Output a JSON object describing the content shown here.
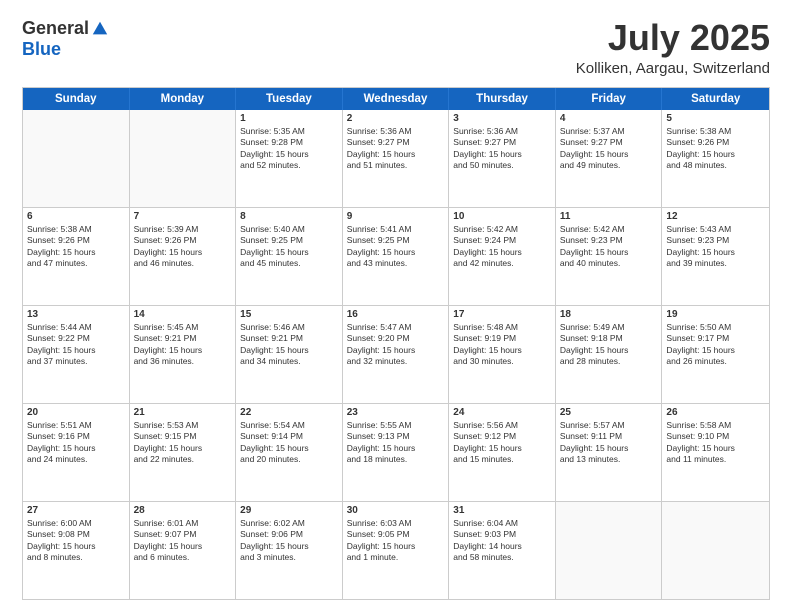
{
  "header": {
    "logo": {
      "general": "General",
      "blue": "Blue"
    },
    "title": "July 2025",
    "subtitle": "Kolliken, Aargau, Switzerland"
  },
  "calendar": {
    "days": [
      "Sunday",
      "Monday",
      "Tuesday",
      "Wednesday",
      "Thursday",
      "Friday",
      "Saturday"
    ],
    "rows": [
      [
        {
          "day": "",
          "empty": true
        },
        {
          "day": "",
          "empty": true
        },
        {
          "day": "1",
          "sunrise": "Sunrise: 5:35 AM",
          "sunset": "Sunset: 9:28 PM",
          "daylight": "Daylight: 15 hours and 52 minutes."
        },
        {
          "day": "2",
          "sunrise": "Sunrise: 5:36 AM",
          "sunset": "Sunset: 9:27 PM",
          "daylight": "Daylight: 15 hours and 51 minutes."
        },
        {
          "day": "3",
          "sunrise": "Sunrise: 5:36 AM",
          "sunset": "Sunset: 9:27 PM",
          "daylight": "Daylight: 15 hours and 50 minutes."
        },
        {
          "day": "4",
          "sunrise": "Sunrise: 5:37 AM",
          "sunset": "Sunset: 9:27 PM",
          "daylight": "Daylight: 15 hours and 49 minutes."
        },
        {
          "day": "5",
          "sunrise": "Sunrise: 5:38 AM",
          "sunset": "Sunset: 9:26 PM",
          "daylight": "Daylight: 15 hours and 48 minutes."
        }
      ],
      [
        {
          "day": "6",
          "sunrise": "Sunrise: 5:38 AM",
          "sunset": "Sunset: 9:26 PM",
          "daylight": "Daylight: 15 hours and 47 minutes."
        },
        {
          "day": "7",
          "sunrise": "Sunrise: 5:39 AM",
          "sunset": "Sunset: 9:26 PM",
          "daylight": "Daylight: 15 hours and 46 minutes."
        },
        {
          "day": "8",
          "sunrise": "Sunrise: 5:40 AM",
          "sunset": "Sunset: 9:25 PM",
          "daylight": "Daylight: 15 hours and 45 minutes."
        },
        {
          "day": "9",
          "sunrise": "Sunrise: 5:41 AM",
          "sunset": "Sunset: 9:25 PM",
          "daylight": "Daylight: 15 hours and 43 minutes."
        },
        {
          "day": "10",
          "sunrise": "Sunrise: 5:42 AM",
          "sunset": "Sunset: 9:24 PM",
          "daylight": "Daylight: 15 hours and 42 minutes."
        },
        {
          "day": "11",
          "sunrise": "Sunrise: 5:42 AM",
          "sunset": "Sunset: 9:23 PM",
          "daylight": "Daylight: 15 hours and 40 minutes."
        },
        {
          "day": "12",
          "sunrise": "Sunrise: 5:43 AM",
          "sunset": "Sunset: 9:23 PM",
          "daylight": "Daylight: 15 hours and 39 minutes."
        }
      ],
      [
        {
          "day": "13",
          "sunrise": "Sunrise: 5:44 AM",
          "sunset": "Sunset: 9:22 PM",
          "daylight": "Daylight: 15 hours and 37 minutes."
        },
        {
          "day": "14",
          "sunrise": "Sunrise: 5:45 AM",
          "sunset": "Sunset: 9:21 PM",
          "daylight": "Daylight: 15 hours and 36 minutes."
        },
        {
          "day": "15",
          "sunrise": "Sunrise: 5:46 AM",
          "sunset": "Sunset: 9:21 PM",
          "daylight": "Daylight: 15 hours and 34 minutes."
        },
        {
          "day": "16",
          "sunrise": "Sunrise: 5:47 AM",
          "sunset": "Sunset: 9:20 PM",
          "daylight": "Daylight: 15 hours and 32 minutes."
        },
        {
          "day": "17",
          "sunrise": "Sunrise: 5:48 AM",
          "sunset": "Sunset: 9:19 PM",
          "daylight": "Daylight: 15 hours and 30 minutes."
        },
        {
          "day": "18",
          "sunrise": "Sunrise: 5:49 AM",
          "sunset": "Sunset: 9:18 PM",
          "daylight": "Daylight: 15 hours and 28 minutes."
        },
        {
          "day": "19",
          "sunrise": "Sunrise: 5:50 AM",
          "sunset": "Sunset: 9:17 PM",
          "daylight": "Daylight: 15 hours and 26 minutes."
        }
      ],
      [
        {
          "day": "20",
          "sunrise": "Sunrise: 5:51 AM",
          "sunset": "Sunset: 9:16 PM",
          "daylight": "Daylight: 15 hours and 24 minutes."
        },
        {
          "day": "21",
          "sunrise": "Sunrise: 5:53 AM",
          "sunset": "Sunset: 9:15 PM",
          "daylight": "Daylight: 15 hours and 22 minutes."
        },
        {
          "day": "22",
          "sunrise": "Sunrise: 5:54 AM",
          "sunset": "Sunset: 9:14 PM",
          "daylight": "Daylight: 15 hours and 20 minutes."
        },
        {
          "day": "23",
          "sunrise": "Sunrise: 5:55 AM",
          "sunset": "Sunset: 9:13 PM",
          "daylight": "Daylight: 15 hours and 18 minutes."
        },
        {
          "day": "24",
          "sunrise": "Sunrise: 5:56 AM",
          "sunset": "Sunset: 9:12 PM",
          "daylight": "Daylight: 15 hours and 15 minutes."
        },
        {
          "day": "25",
          "sunrise": "Sunrise: 5:57 AM",
          "sunset": "Sunset: 9:11 PM",
          "daylight": "Daylight: 15 hours and 13 minutes."
        },
        {
          "day": "26",
          "sunrise": "Sunrise: 5:58 AM",
          "sunset": "Sunset: 9:10 PM",
          "daylight": "Daylight: 15 hours and 11 minutes."
        }
      ],
      [
        {
          "day": "27",
          "sunrise": "Sunrise: 6:00 AM",
          "sunset": "Sunset: 9:08 PM",
          "daylight": "Daylight: 15 hours and 8 minutes."
        },
        {
          "day": "28",
          "sunrise": "Sunrise: 6:01 AM",
          "sunset": "Sunset: 9:07 PM",
          "daylight": "Daylight: 15 hours and 6 minutes."
        },
        {
          "day": "29",
          "sunrise": "Sunrise: 6:02 AM",
          "sunset": "Sunset: 9:06 PM",
          "daylight": "Daylight: 15 hours and 3 minutes."
        },
        {
          "day": "30",
          "sunrise": "Sunrise: 6:03 AM",
          "sunset": "Sunset: 9:05 PM",
          "daylight": "Daylight: 15 hours and 1 minute."
        },
        {
          "day": "31",
          "sunrise": "Sunrise: 6:04 AM",
          "sunset": "Sunset: 9:03 PM",
          "daylight": "Daylight: 14 hours and 58 minutes."
        },
        {
          "day": "",
          "empty": true
        },
        {
          "day": "",
          "empty": true
        }
      ]
    ]
  }
}
